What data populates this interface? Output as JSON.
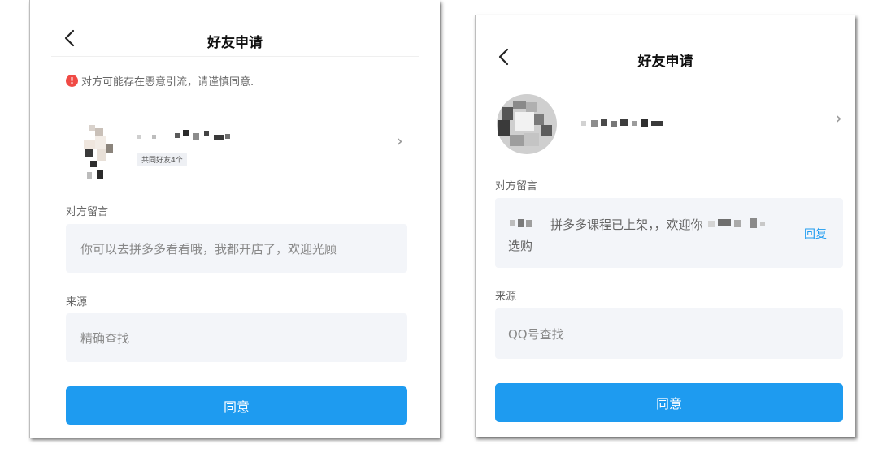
{
  "colors": {
    "accent": "#1e9bf0",
    "warning": "#f04a45",
    "field_bg": "#f3f5f9",
    "link": "#1e9bf0"
  },
  "left": {
    "title": "好友申请",
    "back_icon": "chevron-left-icon",
    "warning_text": "对方可能存在恶意引流，请谨慎同意.",
    "mutual_friends": "共同好友4个",
    "message_label": "对方留言",
    "message_text": "你可以去拼多多看看哦，我都开店了，欢迎光顾",
    "source_label": "来源",
    "source_text": "精确查找",
    "agree_label": "同意"
  },
  "right": {
    "title": "好友申请",
    "back_icon": "chevron-left-icon",
    "message_label": "对方留言",
    "message_line1": "拼多多课程已上架，，欢迎你",
    "message_line2": "选购",
    "reply_label": "回复",
    "source_label": "来源",
    "source_text": "QQ号查找",
    "agree_label": "同意"
  }
}
